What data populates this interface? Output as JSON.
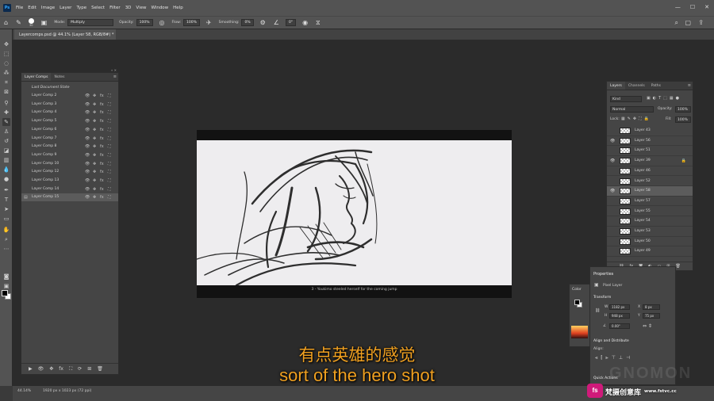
{
  "menu": {
    "app_icon": "Ps",
    "items": [
      "File",
      "Edit",
      "Image",
      "Layer",
      "Type",
      "Select",
      "Filter",
      "3D",
      "View",
      "Window",
      "Help"
    ],
    "window_controls": [
      "—",
      "☐",
      "✕"
    ]
  },
  "options": {
    "brush_size": "30",
    "mode_label": "Mode:",
    "mode_value": "Multiply",
    "opacity_label": "Opacity:",
    "opacity_value": "100%",
    "flow_label": "Flow:",
    "flow_value": "100%",
    "smoothing_label": "Smoothing:",
    "smoothing_value": "0%",
    "angle_value": "0°"
  },
  "document": {
    "tab_title": "Layercomps.psd @ 44.1% (Layer 58, RGB/8#) *",
    "caption": "3 - Youkimo steeled herself for the coming jump"
  },
  "layer_comps": {
    "tabs": [
      "Layer Comps",
      "Notes"
    ],
    "last_state": "Last Document State",
    "items": [
      "Layer Comp 2",
      "Layer Comp 3",
      "Layer Comp 4",
      "Layer Comp 5",
      "Layer Comp 6",
      "Layer Comp 7",
      "Layer Comp 8",
      "Layer Comp 9",
      "Layer Comp 10",
      "Layer Comp 12",
      "Layer Comp 13",
      "Layer Comp 14",
      "Layer Comp 15"
    ],
    "selected": "Layer Comp 15"
  },
  "layers": {
    "tabs": [
      "Layers",
      "Channels",
      "Paths"
    ],
    "kind_label": "Kind",
    "blend_mode": "Normal",
    "opacity_label": "Opacity:",
    "opacity_value": "100%",
    "lock_label": "Lock:",
    "fill_label": "Fill:",
    "fill_value": "100%",
    "items": [
      {
        "name": "Layer 43",
        "visible": false,
        "locked": false
      },
      {
        "name": "Layer 56",
        "visible": true,
        "locked": false
      },
      {
        "name": "Layer 51",
        "visible": false,
        "locked": false
      },
      {
        "name": "Layer 39",
        "visible": true,
        "locked": true
      },
      {
        "name": "Layer 46",
        "visible": false,
        "locked": false
      },
      {
        "name": "Layer 52",
        "visible": false,
        "locked": false
      },
      {
        "name": "Layer 58",
        "visible": true,
        "locked": false
      },
      {
        "name": "Layer 57",
        "visible": false,
        "locked": false
      },
      {
        "name": "Layer 55",
        "visible": false,
        "locked": false
      },
      {
        "name": "Layer 54",
        "visible": false,
        "locked": false
      },
      {
        "name": "Layer 53",
        "visible": false,
        "locked": false
      },
      {
        "name": "Layer 50",
        "visible": false,
        "locked": false
      },
      {
        "name": "Layer 49",
        "visible": false,
        "locked": false
      }
    ],
    "selected": "Layer 58"
  },
  "properties": {
    "title": "Properties",
    "layer_type": "Pixel Layer",
    "transform_label": "Transform",
    "w_label": "W",
    "w_value": "1182 px",
    "h_label": "H",
    "h_value": "948 px",
    "x_label": "X",
    "x_value": "8 px",
    "y_label": "Y",
    "y_value": "75 px",
    "angle_value": "0.00°",
    "align_label": "Align and Distribute",
    "align_sub": "Align:",
    "quick_actions": "Quick Actions"
  },
  "color_panel": {
    "title": "Color"
  },
  "status": {
    "zoom": "44.14%",
    "doc_size": "1920 px x 1023 px (72 ppi)"
  },
  "subtitles": {
    "chinese": "有点英雄的感觉",
    "english": "sort of the hero shot"
  },
  "watermark": {
    "logo_text": "fs",
    "site_name": "梵摄创意库",
    "url": "www.fstvc.cc",
    "brand_bg": "GNOMON"
  },
  "colors": {
    "accent": "#f0a020",
    "ps_blue": "#31a8ff",
    "watermark_pink": "#d01a7a"
  }
}
